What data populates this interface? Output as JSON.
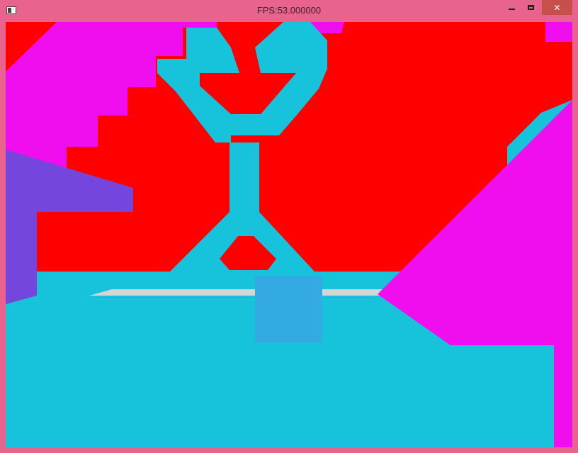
{
  "window": {
    "title": "FPS:53.000000",
    "icon": "app-window-icon",
    "controls": {
      "minimize_icon": "minimize-icon",
      "maximize_icon": "maximize-icon",
      "close_icon": "close-icon",
      "close_glyph": "✕"
    },
    "colors": {
      "frame": "#E8648C",
      "close_button": "#C7504A"
    }
  },
  "scene": {
    "colors": {
      "background": "#FF0000",
      "magenta": "#EE0EEE",
      "cyan": "#16C3DB",
      "purple": "#7446DC",
      "floor_edge": "#D5D5D5",
      "block": "#33AAE2"
    }
  }
}
